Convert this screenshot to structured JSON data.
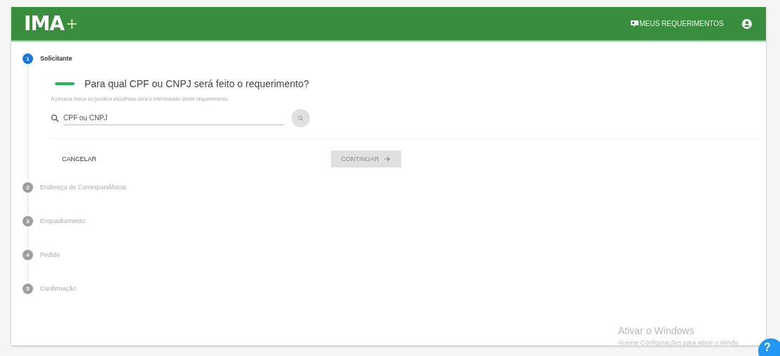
{
  "header": {
    "logo_text": "IMA",
    "logo_plus": "+",
    "nav_link": "MEUS REQUERIMENTOS"
  },
  "steps": [
    {
      "number": "1",
      "label": "Solicitante",
      "selected": true,
      "kind": "expanded"
    },
    {
      "number": "2",
      "label": "Endereço de Correspondência",
      "selected": false,
      "kind": "collapsed"
    },
    {
      "number": "3",
      "label": "Enquadramento",
      "selected": false,
      "kind": "collapsed"
    },
    {
      "number": "4",
      "label": "Pedido",
      "selected": false,
      "kind": "collapsed"
    },
    {
      "number": "5",
      "label": "Confirmação",
      "selected": false,
      "kind": "collapsed"
    }
  ],
  "form": {
    "question": "Para qual CPF ou CNPJ será feito o requerimento?",
    "hint": "A pessoa física ou jurídica escolhida será o interessado deste requerimento.",
    "search": {
      "placeholder": "CPF ou CNPJ"
    },
    "cancel_button": "CANCELAR",
    "continue_button": {
      "label": "CONTINUAR",
      "disabled": true
    }
  },
  "activation_notice": {
    "title": "Ativar o Windows",
    "message": "Acesse Configurações para ativar o Windo"
  },
  "help_button": "?"
}
